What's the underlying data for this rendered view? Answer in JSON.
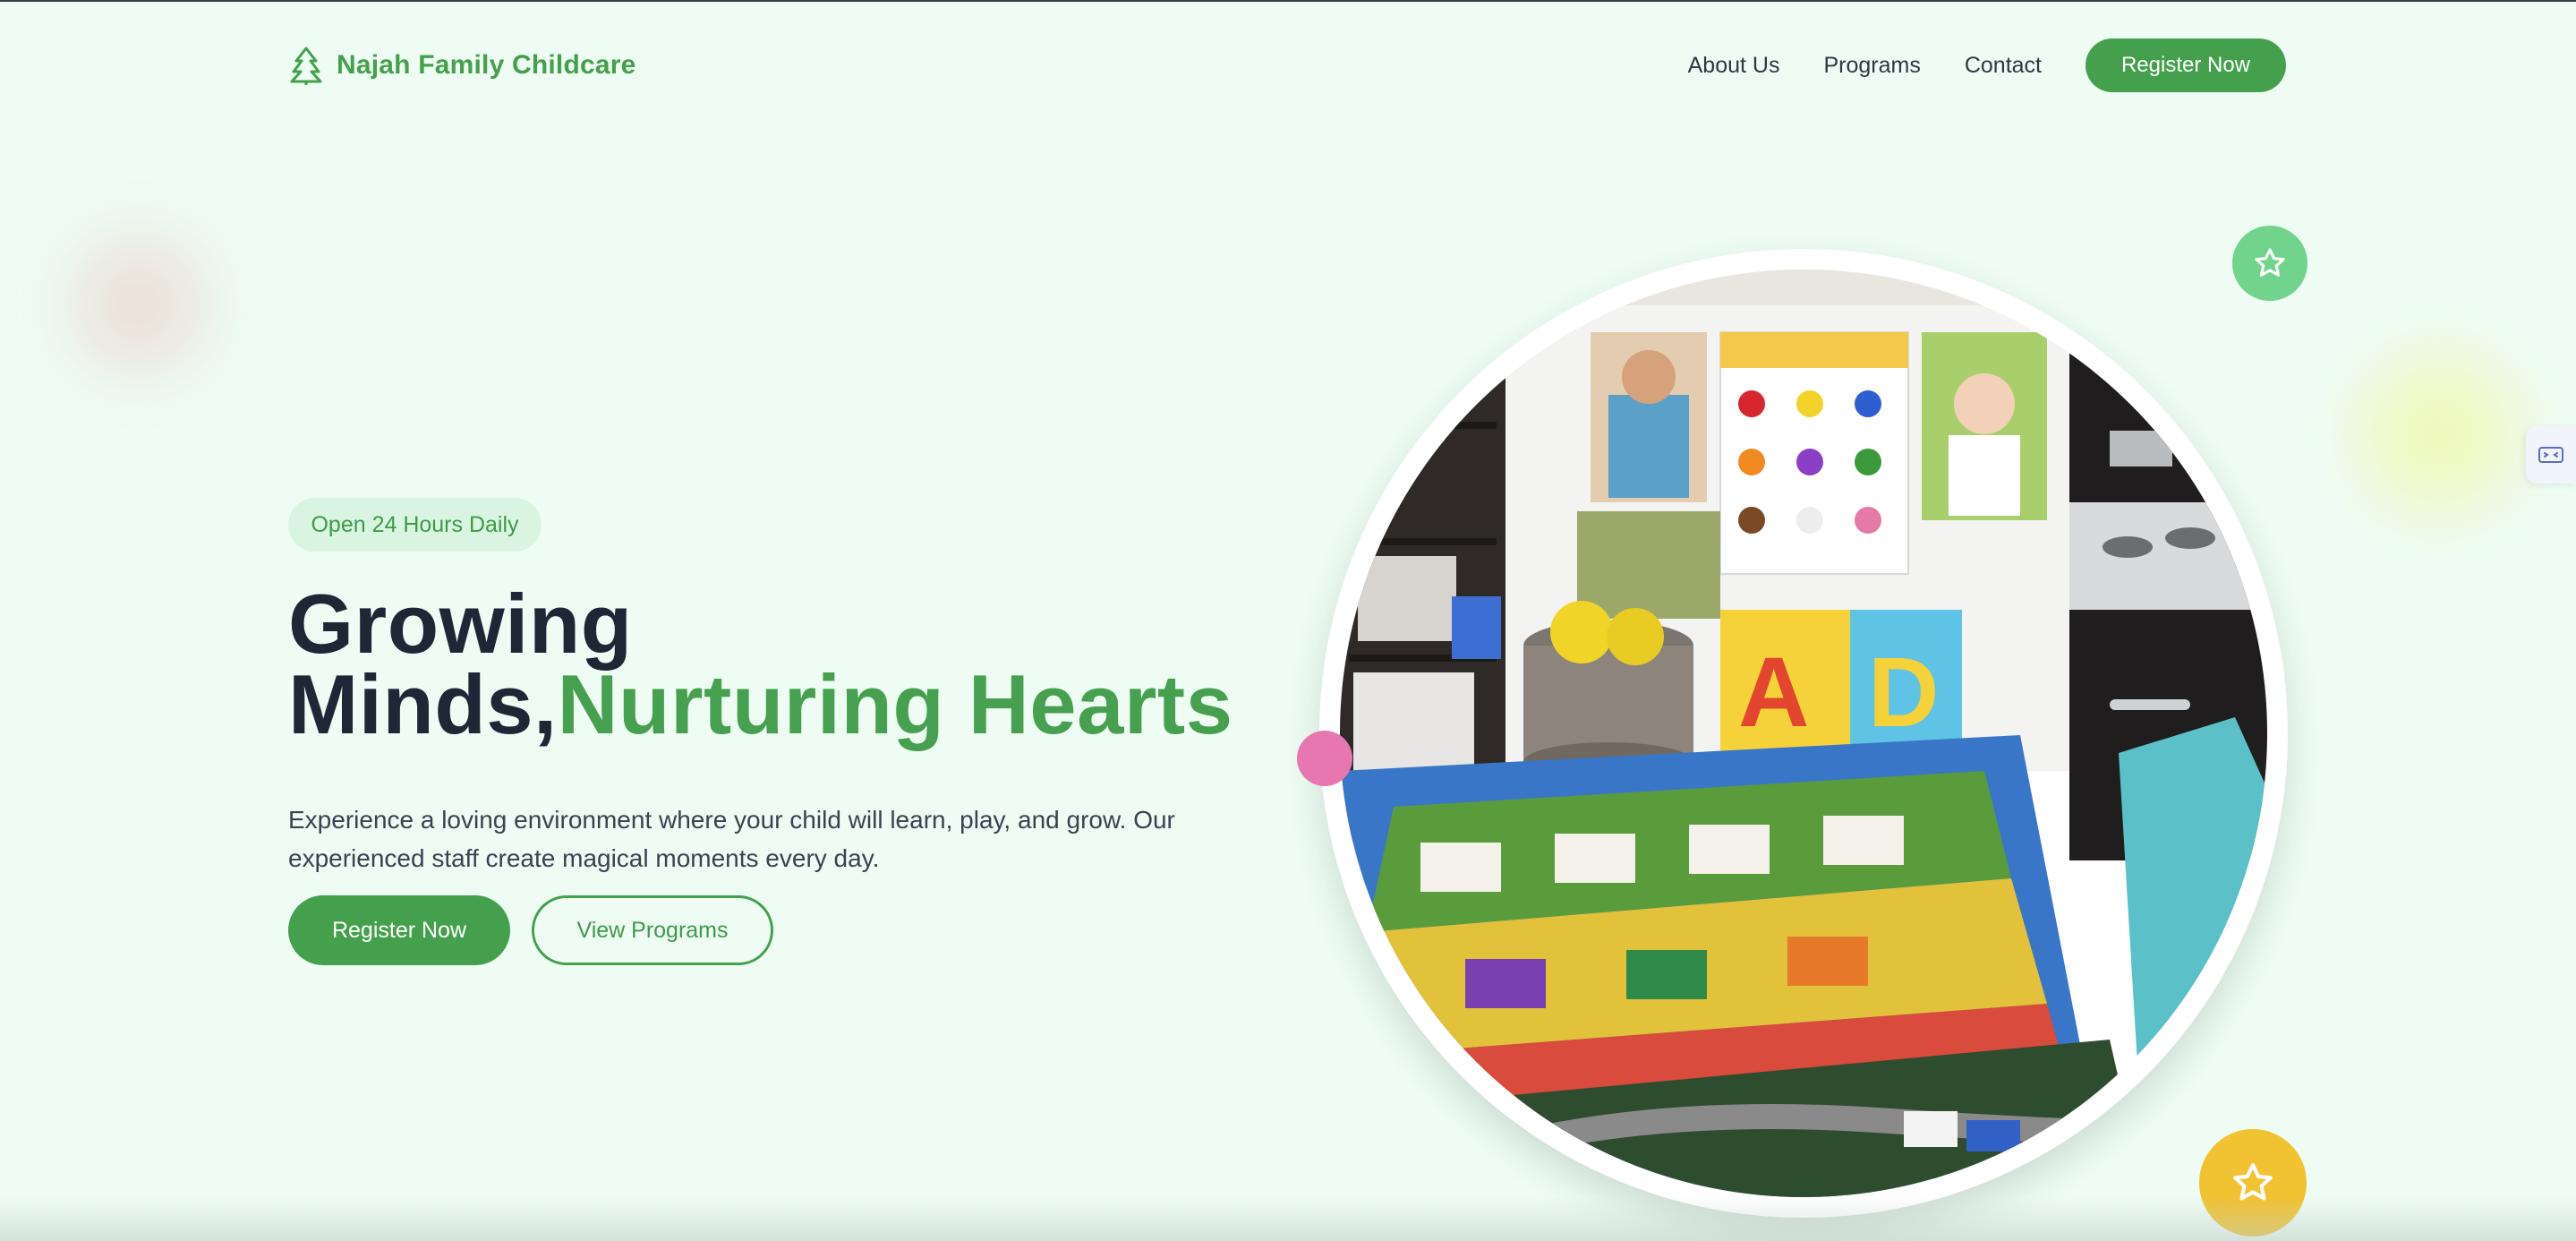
{
  "header": {
    "brand": {
      "name": "Najah Family Childcare",
      "icon": "tree-icon"
    },
    "nav": [
      {
        "label": "About Us"
      },
      {
        "label": "Programs"
      },
      {
        "label": "Contact"
      }
    ],
    "cta_label": "Register Now"
  },
  "hero": {
    "badge": "Open 24 Hours Daily",
    "headline_line1": "Growing",
    "headline_line2_dark": "Minds,",
    "headline_line2_accent": "Nurturing Hearts",
    "subtext": "Experience a loving environment where your child will learn, play, and grow. Our experienced staff create magical moments every day.",
    "primary_button": "Register Now",
    "secondary_button": "View Programs",
    "image": {
      "subject": "classroom-play-area-photo",
      "icon": "photo"
    }
  },
  "decorations": {
    "star_badge_top": {
      "icon": "star-icon",
      "color": "#72d38d"
    },
    "star_badge_bottom": {
      "icon": "star-icon",
      "color": "#f1c232"
    },
    "dot_color": "#e677b0",
    "side_tab_icon": "chat-icon"
  },
  "colors": {
    "brand_green": "#45a04d",
    "background": "#eefcf4",
    "headline_dark": "#1f2636",
    "badge_bg": "#d9f5e1"
  }
}
